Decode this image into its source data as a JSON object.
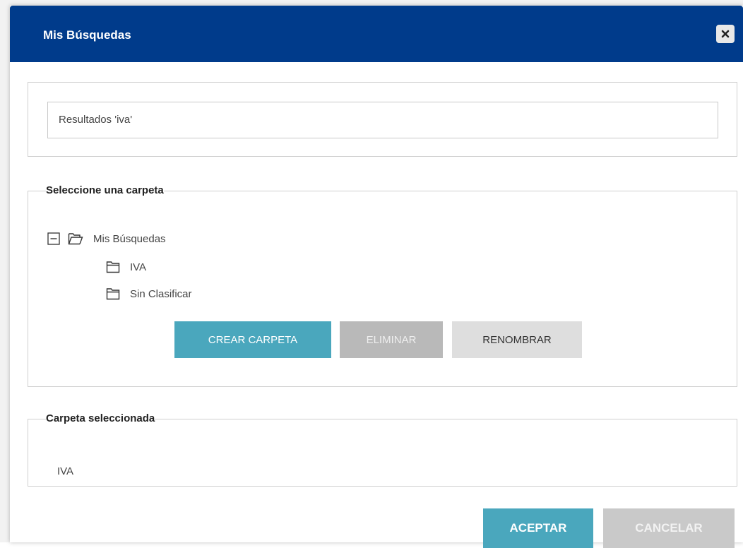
{
  "dialog": {
    "title": "Mis Búsquedas",
    "close_icon": "close-icon",
    "header_color": "#003b8b"
  },
  "search_name": {
    "value": "Resultados  'iva'"
  },
  "folders": {
    "legend": "Seleccione una carpeta",
    "tree": {
      "root": {
        "label": "Mis Búsquedas",
        "expanded": true,
        "icon": "folder-open-icon",
        "expander_icon": "collapse-minus-icon"
      },
      "children": [
        {
          "label": "IVA",
          "icon": "folder-icon"
        },
        {
          "label": "Sin Clasificar",
          "icon": "folder-icon"
        }
      ]
    },
    "buttons": {
      "create": "CREAR CARPETA",
      "delete": "ELIMINAR",
      "rename": "RENOMBRAR"
    }
  },
  "selected": {
    "legend": "Carpeta seleccionada",
    "value": "IVA"
  },
  "footer": {
    "accept": "ACEPTAR",
    "cancel": "CANCELAR"
  },
  "colors": {
    "accent": "#4aa7bd",
    "disabled": "#b9b9b9",
    "secondary": "#dedede"
  }
}
